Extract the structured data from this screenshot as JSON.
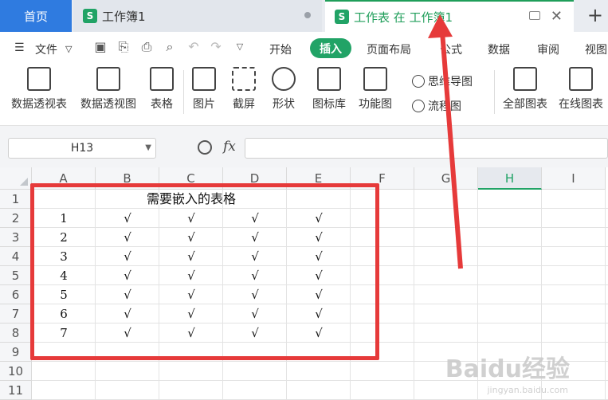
{
  "tabs": {
    "home": "首页",
    "tab1": "工作簿1",
    "tab2": "工作表 在 工作簿1",
    "sheet_icon_letter": "S"
  },
  "menu": {
    "file": "文件",
    "items": [
      "开始",
      "插入",
      "页面布局",
      "公式",
      "数据",
      "审阅",
      "视图"
    ],
    "active": "插入"
  },
  "ribbon": {
    "pivot_table": "数据透视表",
    "pivot_chart": "数据透视图",
    "table": "表格",
    "picture": "图片",
    "screenshot": "截屏",
    "shape": "形状",
    "icon_lib": "图标库",
    "func_chart": "功能图",
    "mindmap": "思维导图",
    "flowchart": "流程图",
    "all_charts": "全部图表",
    "online_charts": "在线图表"
  },
  "formula_bar": {
    "name_box": "H13",
    "fx": "fx",
    "value": ""
  },
  "grid": {
    "columns": [
      "A",
      "B",
      "C",
      "D",
      "E",
      "F",
      "G",
      "H",
      "I"
    ],
    "active_column": "H",
    "rows": [
      "1",
      "2",
      "3",
      "4",
      "5",
      "6",
      "7",
      "8",
      "9",
      "10",
      "11"
    ],
    "title": "需要嵌入的表格",
    "data": [
      [
        "1",
        "√",
        "√",
        "√",
        "√"
      ],
      [
        "2",
        "√",
        "√",
        "√",
        "√"
      ],
      [
        "3",
        "√",
        "√",
        "√",
        "√"
      ],
      [
        "4",
        "√",
        "√",
        "√",
        "√"
      ],
      [
        "5",
        "√",
        "√",
        "√",
        "√"
      ],
      [
        "6",
        "√",
        "√",
        "√",
        "√"
      ],
      [
        "7",
        "√",
        "√",
        "√",
        "√"
      ]
    ]
  },
  "colors": {
    "accent_green": "#21a366",
    "home_blue": "#2f7be0",
    "annotation_red": "#e63a3a"
  },
  "watermark": "Baidu经验",
  "watermark_sub": "jingyan.baidu.com"
}
